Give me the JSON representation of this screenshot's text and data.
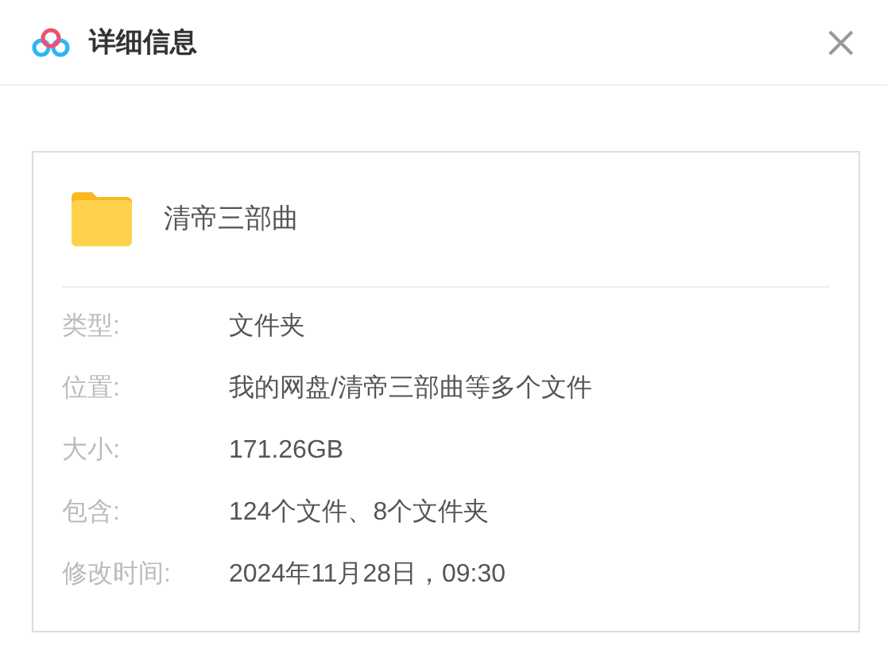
{
  "window": {
    "title": "详细信息"
  },
  "item": {
    "name": "清帝三部曲"
  },
  "details": [
    {
      "label": "类型:",
      "value": "文件夹"
    },
    {
      "label": "位置:",
      "value": "我的网盘/清帝三部曲等多个文件"
    },
    {
      "label": "大小:",
      "value": "171.26GB"
    },
    {
      "label": "包含:",
      "value": "124个文件、8个文件夹"
    },
    {
      "label": "修改时间:",
      "value": "2024年11月28日，09:30"
    }
  ]
}
